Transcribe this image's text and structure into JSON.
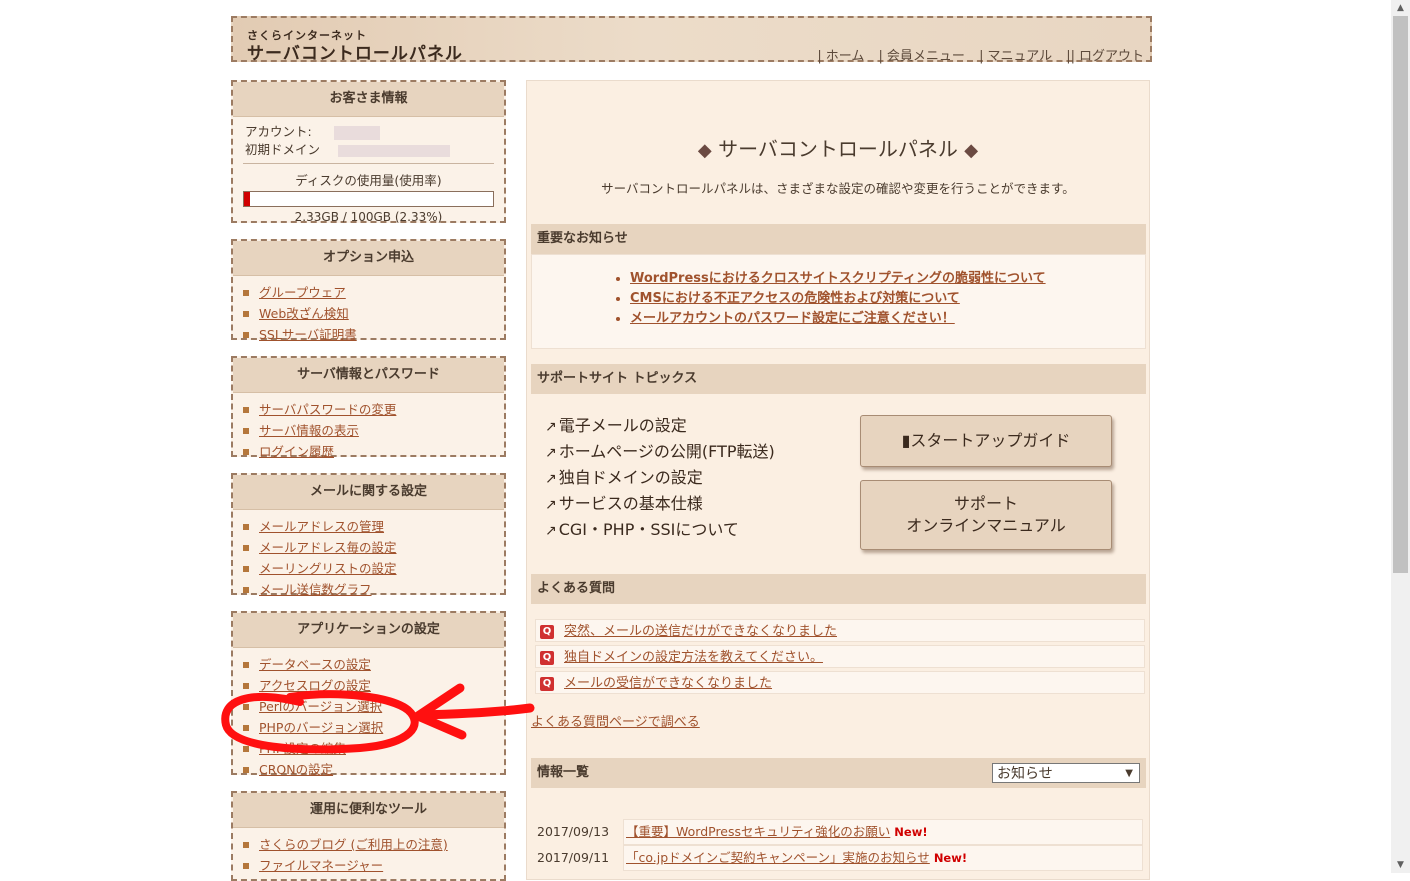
{
  "header": {
    "logo_small": "さくらインターネット",
    "logo_big": "サーバコントロールパネル",
    "nav": [
      "ホーム",
      "会員メニュー",
      "マニュアル",
      "ログアウト"
    ]
  },
  "customer": {
    "title": "お客さま情報",
    "account_label": "アカウント:",
    "domain_label": "初期ドメイン",
    "disk_title": "ディスクの使用量(使用率)",
    "disk_usage_percent": 2.33,
    "disk_text": "2.33GB / 100GB (2.33%)"
  },
  "sidebar": [
    {
      "title": "オプション申込",
      "items": [
        "グループウェア",
        "Web改ざん検知",
        "SSLサーバ証明書"
      ]
    },
    {
      "title": "サーバ情報とパスワード",
      "items": [
        "サーバパスワードの変更",
        "サーバ情報の表示",
        "ログイン履歴"
      ]
    },
    {
      "title": "メールに関する設定",
      "items": [
        "メールアドレスの管理",
        "メールアドレス毎の設定",
        "メーリングリストの設定",
        "メール送信数グラフ"
      ]
    },
    {
      "title": "アプリケーションの設定",
      "items": [
        "データベースの設定",
        "アクセスログの設定",
        "Perlのバージョン選択",
        "PHPのバージョン選択",
        "PHP設定の編集",
        "CRONの設定"
      ]
    },
    {
      "title": "運用に便利なツール",
      "items": [
        "さくらのブログ (ご利用上の注意)",
        "ファイルマネージャー"
      ]
    }
  ],
  "main": {
    "title": "サーバコントロールパネル",
    "diamond": "◆",
    "desc": "サーバコントロールパネルは、さまざまな設定の確認や変更を行うことができます。",
    "notices_title": "重要なお知らせ",
    "notices": [
      "WordPressにおけるクロスサイトスクリプティングの脆弱性について",
      "CMSにおける不正アクセスの危険性および対策について",
      "メールアカウントのパスワード設定にご注意ください！"
    ],
    "support_title": "サポートサイト トピックス",
    "topics": [
      "電子メールの設定",
      "ホームページの公開(FTP転送)",
      "独自ドメインの設定",
      "サービスの基本仕様",
      "CGI・PHP・SSIについて"
    ],
    "btn_startup": "スタートアップガイド",
    "btn_support_line1": "サポート",
    "btn_support_line2": "オンラインマニュアル",
    "faq_title": "よくある質問",
    "faq_q": "Q",
    "faqs": [
      "突然、メールの送信だけができなくなりました",
      "独自ドメインの設定方法を教えてください。",
      "メールの受信ができなくなりました"
    ],
    "faq_more": "よくある質問ページで調べる",
    "info_title": "情報一覧",
    "info_select": "お知らせ",
    "news": [
      {
        "date": "2017/09/13",
        "title": "【重要】WordPressセキュリティ強化のお願い",
        "badge": "New!"
      },
      {
        "date": "2017/09/11",
        "title": "「co.jpドメインご契約キャンペーン」実施のお知らせ",
        "badge": "New!"
      }
    ]
  }
}
